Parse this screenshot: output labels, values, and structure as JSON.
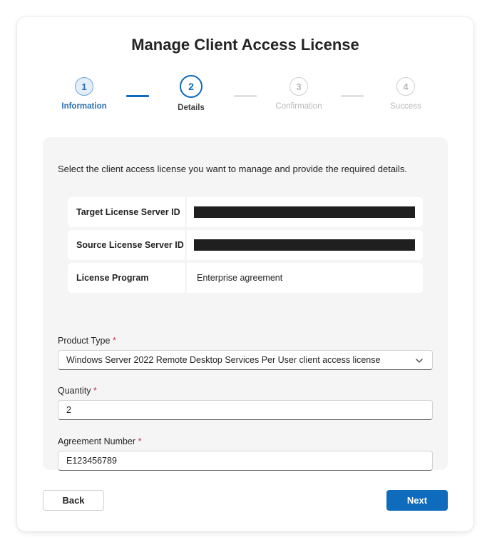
{
  "title": "Manage Client Access License",
  "steps": [
    {
      "number": "1",
      "label": "Information",
      "state": "done"
    },
    {
      "number": "2",
      "label": "Details",
      "state": "active"
    },
    {
      "number": "3",
      "label": "Confirmation",
      "state": "todo"
    },
    {
      "number": "4",
      "label": "Success",
      "state": "todo"
    }
  ],
  "intro": "Select the client access license you want to manage and provide the required details.",
  "info": [
    {
      "label": "Target License Server ID",
      "value": "",
      "redacted": true
    },
    {
      "label": "Source License Server ID",
      "value": "",
      "redacted": true
    },
    {
      "label": "License Program",
      "value": "Enterprise agreement",
      "redacted": false
    }
  ],
  "form": {
    "product_type": {
      "label": "Product Type",
      "required": "*",
      "value": "Windows Server 2022 Remote Desktop Services Per User client access license"
    },
    "quantity": {
      "label": "Quantity",
      "required": "*",
      "value": "2"
    },
    "agreement_number": {
      "label": "Agreement Number",
      "required": "*",
      "value": "E123456789"
    }
  },
  "buttons": {
    "back": "Back",
    "next": "Next"
  },
  "colors": {
    "accent": "#0f6cbd",
    "required": "#c4314b",
    "panel": "#f5f5f5"
  }
}
